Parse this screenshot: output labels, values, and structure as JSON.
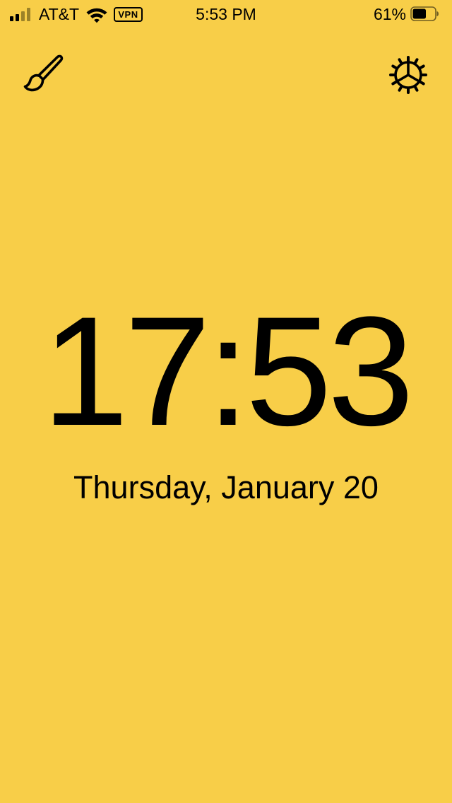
{
  "status_bar": {
    "carrier": "AT&T",
    "vpn_label": "VPN",
    "time": "5:53 PM",
    "battery_percent": "61%",
    "battery_level": 0.61,
    "signal_bars_active": 2,
    "signal_bars_total": 4
  },
  "toolbar": {
    "left_icon": "paintbrush-icon",
    "right_icon": "gear-icon"
  },
  "clock": {
    "time": "17:53",
    "date": "Thursday, January 20"
  },
  "colors": {
    "background": "#f8ce48",
    "foreground": "#000000",
    "inactive_signal": "#9c8228"
  }
}
